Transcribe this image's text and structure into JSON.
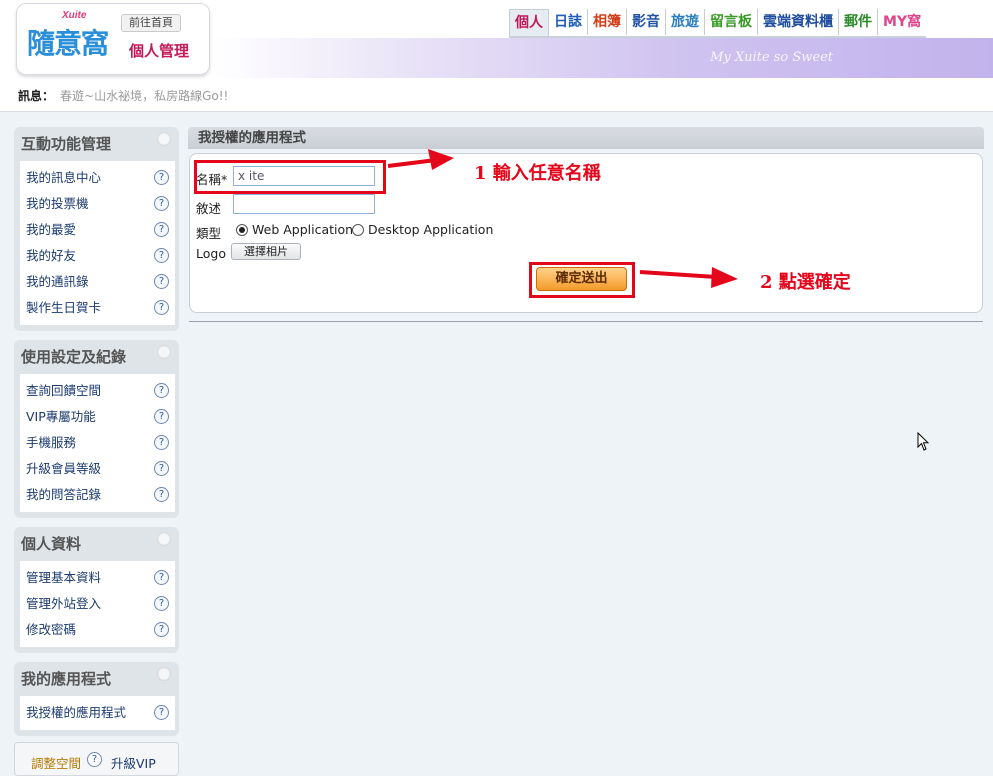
{
  "header": {
    "brand_small": "Xuite",
    "brand_big": "隨意窩",
    "home_link": "前往首頁",
    "section_title": "個人管理",
    "slogan": "My Xuite so Sweet",
    "nav": [
      {
        "label": "個人",
        "color": "#c0185a"
      },
      {
        "label": "日誌",
        "color": "#1f5bb8"
      },
      {
        "label": "相簿",
        "color": "#d43d1a"
      },
      {
        "label": "影音",
        "color": "#2255a8"
      },
      {
        "label": "旅遊",
        "color": "#2a7dc2"
      },
      {
        "label": "留言板",
        "color": "#3a9a28"
      },
      {
        "label": "雲端資料櫃",
        "color": "#1f4ea0"
      },
      {
        "label": "郵件",
        "color": "#2a8a2a"
      },
      {
        "label": "MY窩",
        "color": "#e0458c"
      }
    ]
  },
  "notice": {
    "label": "訊息：",
    "text": "春遊~山水祕境，私房路線Go!!"
  },
  "sidebar": {
    "panels": [
      {
        "title": "互動功能管理",
        "items": [
          "我的訊息中心",
          "我的投票機",
          "我的最愛",
          "我的好友",
          "我的通訊錄",
          "製作生日賀卡"
        ]
      },
      {
        "title": "使用設定及紀錄",
        "items": [
          "查詢回饋空間",
          "VIP專屬功能",
          "手機服務",
          "升級會員等級",
          "我的問答記錄"
        ]
      },
      {
        "title": "個人資料",
        "items": [
          "管理基本資料",
          "管理外站登入",
          "修改密碼"
        ]
      },
      {
        "title": "我的應用程式",
        "items": [
          "我授權的應用程式"
        ]
      }
    ],
    "footer": {
      "adjust": "調整空間",
      "upgrade": "升級VIP"
    }
  },
  "main": {
    "title": "我授權的應用程式",
    "form": {
      "name_label": "名稱*",
      "name_value": "x     ite",
      "desc_label": "敘述",
      "desc_value": "",
      "type_label": "類型",
      "type_options": [
        "Web Application",
        "Desktop Application"
      ],
      "type_selected": "Web Application",
      "logo_label": "Logo",
      "choose_photo": "選擇相片",
      "submit": "確定送出"
    }
  },
  "annotations": {
    "step1": "1 輸入任意名稱",
    "step2": "2 點選確定",
    "color": "#e4061b"
  }
}
